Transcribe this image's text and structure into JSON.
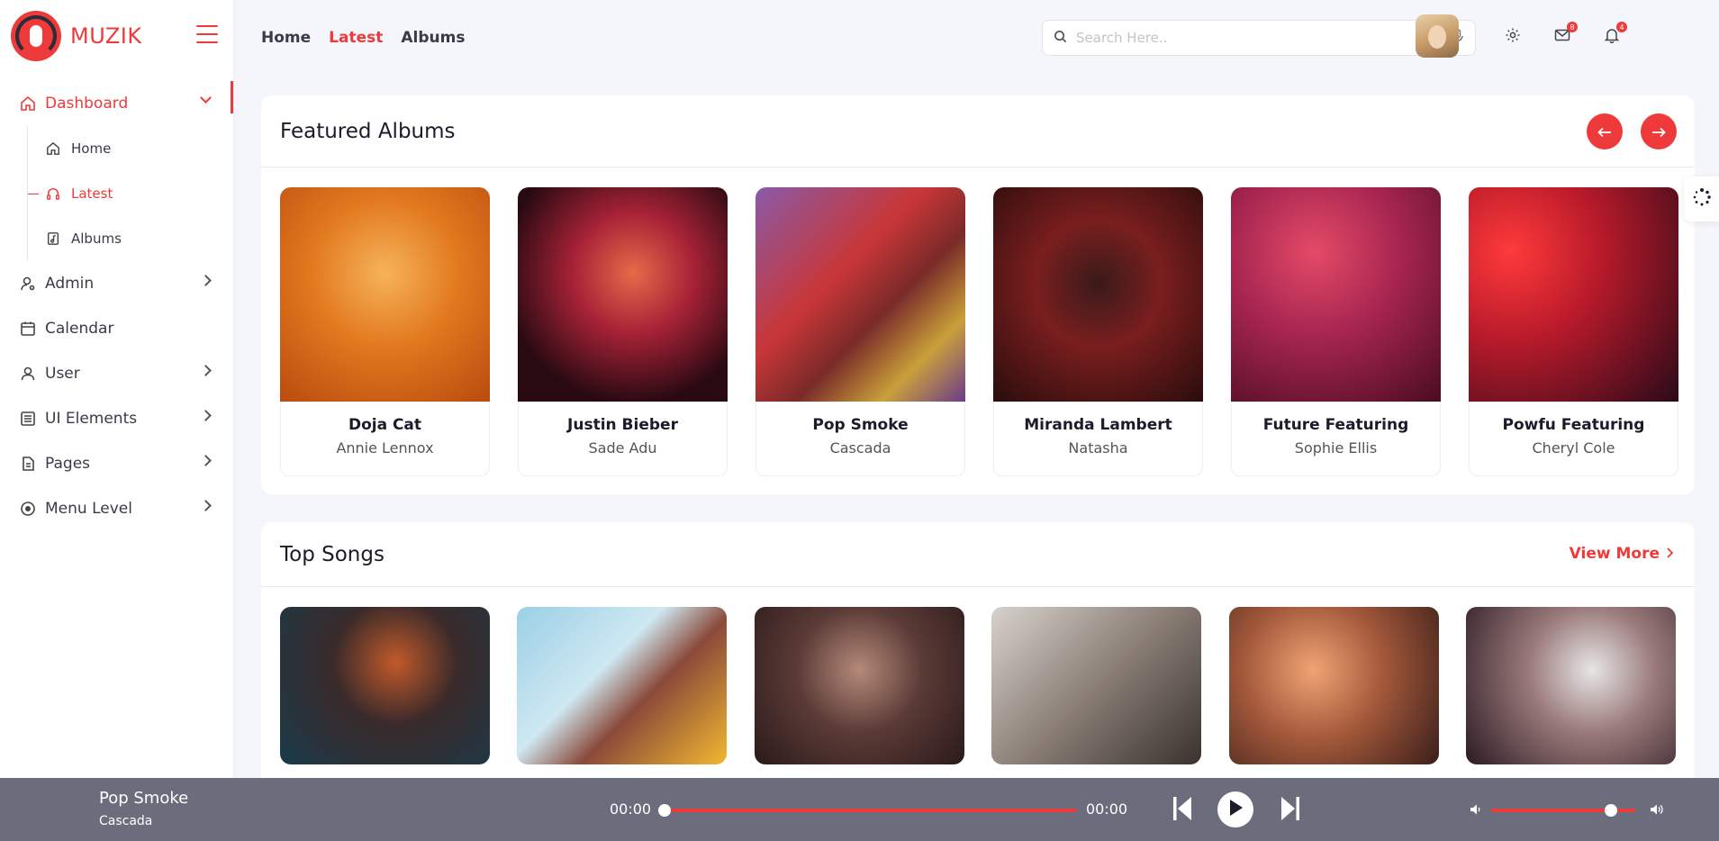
{
  "brand": {
    "name": "MUZIK"
  },
  "sidebar": {
    "items": [
      {
        "label": "Dashboard",
        "icon": "home-icon",
        "expanded": true,
        "children": [
          {
            "label": "Home",
            "icon": "home-icon"
          },
          {
            "label": "Latest",
            "icon": "headphones-icon",
            "active": true
          },
          {
            "label": "Albums",
            "icon": "music-file-icon"
          }
        ]
      },
      {
        "label": "Admin",
        "icon": "user-gear-icon"
      },
      {
        "label": "Calendar",
        "icon": "calendar-icon"
      },
      {
        "label": "User",
        "icon": "user-icon"
      },
      {
        "label": "UI Elements",
        "icon": "list-icon"
      },
      {
        "label": "Pages",
        "icon": "document-icon"
      },
      {
        "label": "Menu Level",
        "icon": "target-icon"
      }
    ]
  },
  "header": {
    "links": [
      "Home",
      "Latest",
      "Albums"
    ],
    "active_link": "Latest",
    "search_placeholder": "Search Here..",
    "mail_badge": "8",
    "bell_badge": "4"
  },
  "featured": {
    "title": "Featured Albums",
    "albums": [
      {
        "title": "Doja Cat",
        "artist": "Annie Lennox"
      },
      {
        "title": "Justin Bieber",
        "artist": "Sade Adu"
      },
      {
        "title": "Pop Smoke",
        "artist": "Cascada"
      },
      {
        "title": "Miranda Lambert",
        "artist": "Natasha"
      },
      {
        "title": "Future Featuring",
        "artist": "Sophie Ellis"
      },
      {
        "title": "Powfu Featuring",
        "artist": "Cheryl Cole"
      }
    ]
  },
  "top_songs": {
    "title": "Top Songs",
    "view_more": "View More"
  },
  "player": {
    "title": "Pop Smoke",
    "artist": "Cascada",
    "current_time": "00:00",
    "total_time": "00:00",
    "progress": 0,
    "volume": 0.83
  },
  "colors": {
    "accent": "#ee3a3a",
    "player_bg": "#6b6d7c"
  }
}
